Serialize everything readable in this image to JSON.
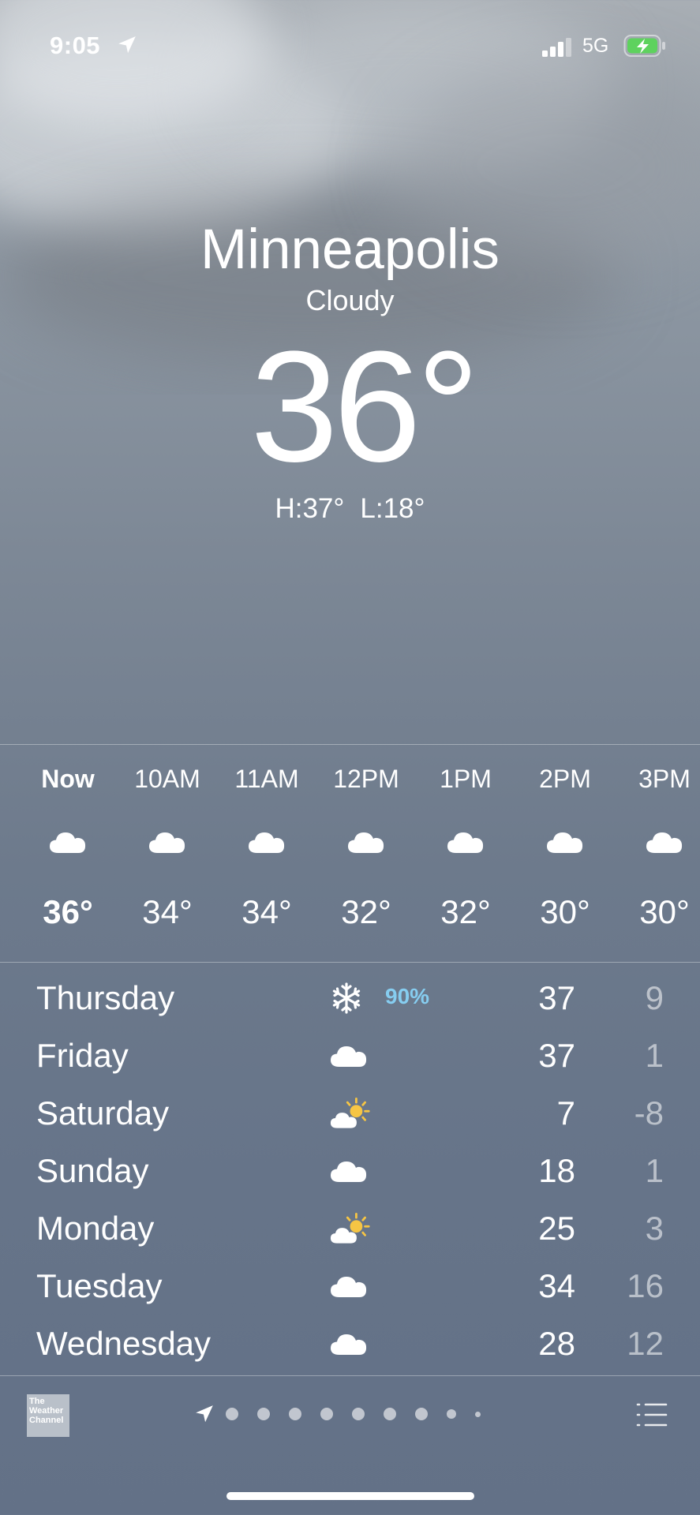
{
  "status_bar": {
    "time": "9:05",
    "network": "5G",
    "battery_charging": true
  },
  "location": {
    "city": "Minneapolis",
    "condition": "Cloudy",
    "temperature": "36°",
    "high": "H:37°",
    "low": "L:18°"
  },
  "hourly": [
    {
      "label": "Now",
      "temp": "36°",
      "icon": "cloud-icon",
      "bold": true
    },
    {
      "label": "10AM",
      "temp": "34°",
      "icon": "cloud-icon"
    },
    {
      "label": "11AM",
      "temp": "34°",
      "icon": "cloud-icon"
    },
    {
      "label": "12PM",
      "temp": "32°",
      "icon": "cloud-icon"
    },
    {
      "label": "1PM",
      "temp": "32°",
      "icon": "cloud-icon"
    },
    {
      "label": "2PM",
      "temp": "30°",
      "icon": "cloud-icon"
    },
    {
      "label": "3PM",
      "temp": "30°",
      "icon": "cloud-icon"
    }
  ],
  "daily": [
    {
      "day": "Thursday",
      "icon": "snowflake-icon",
      "precip": "90%",
      "high": "37",
      "low": "9"
    },
    {
      "day": "Friday",
      "icon": "cloud-icon",
      "precip": "",
      "high": "37",
      "low": "1"
    },
    {
      "day": "Saturday",
      "icon": "partly-sunny-icon",
      "precip": "",
      "high": "7",
      "low": "-8"
    },
    {
      "day": "Sunday",
      "icon": "cloud-icon",
      "precip": "",
      "high": "18",
      "low": "1"
    },
    {
      "day": "Monday",
      "icon": "partly-sunny-icon",
      "precip": "",
      "high": "25",
      "low": "3"
    },
    {
      "day": "Tuesday",
      "icon": "cloud-icon",
      "precip": "",
      "high": "34",
      "low": "16"
    },
    {
      "day": "Wednesday",
      "icon": "cloud-icon",
      "precip": "",
      "high": "28",
      "low": "12"
    }
  ],
  "footer": {
    "provider_logo": "The Weather Channel",
    "page_dots": 8,
    "active_page": "current-location"
  },
  "colors": {
    "precip": "#86cdf0",
    "sun": "#f6c544",
    "battery": "#5ed25e"
  }
}
